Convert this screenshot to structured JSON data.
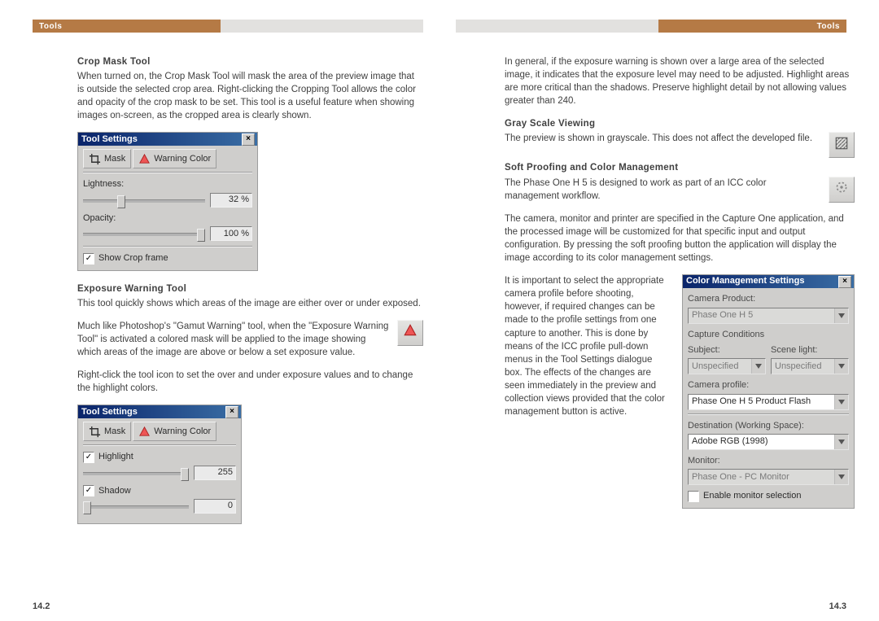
{
  "header": {
    "left": "Tools",
    "right": "Tools"
  },
  "footer": {
    "left": "14.2",
    "right": "14.3"
  },
  "left": {
    "h1": "Crop Mask Tool",
    "p1": "When turned on, the Crop Mask Tool will mask the area of the preview image that is outside the selected crop area. Right-clicking the Cropping Tool allows the color and opacity of the crop mask to be set. This tool is a useful feature when showing images on-screen, as the cropped area is clearly shown.",
    "dlg1": {
      "title": "Tool Settings",
      "btn_mask": "Mask",
      "btn_warn": "Warning Color",
      "lbl_lightness": "Lightness:",
      "val_lightness": "32 %",
      "lbl_opacity": "Opacity:",
      "val_opacity": "100 %",
      "chk_frame": "Show Crop frame"
    },
    "h2": "Exposure Warning Tool",
    "p2": "This tool quickly shows which areas of the image are either over or under exposed.",
    "p3": "Much like Photoshop's \"Gamut Warning\" tool, when the \"Exposure Warning Tool\" is activated a colored mask will be applied to the image showing which areas of the image are above or below a set exposure value.",
    "p4": "Right-click the tool icon to set the over and under exposure values and to change the highlight colors.",
    "dlg2": {
      "title": "Tool Settings",
      "btn_mask": "Mask",
      "btn_warn": "Warning Color",
      "chk_high": "Highlight",
      "val_high": "255",
      "chk_shadow": "Shadow",
      "val_shadow": "0"
    }
  },
  "right": {
    "p1": "In general, if the exposure warning is shown over a large area of the selected image, it indicates that the exposure level may need to be adjusted. Highlight areas are more critical than the shadows. Preserve highlight detail by not allowing values greater than 240.",
    "h1": "Gray Scale Viewing",
    "p2": "The preview is shown in grayscale. This does not affect the developed file.",
    "h2": "Soft Proofing and Color Management",
    "p3": "The Phase One H 5 is designed to work as part of an ICC color management workflow.",
    "p4": "The camera, monitor and printer are specified in the Capture One application, and the processed image will be customized for that specific input and output configuration. By pressing the soft proofing button the application will display the image according to its color management settings.",
    "p5": "It is important to select the appropriate camera profile before shooting, however, if required changes can be made to the profile settings from one capture to another. This is done by means of the ICC profile pull-down menus in the Tool Settings dialogue box. The effects of the changes are seen immediately in the preview and collection views provided that the color management button is active.",
    "cms": {
      "title": "Color Management Settings",
      "lbl_camprod": "Camera Product:",
      "val_camprod": "Phase One H 5",
      "lbl_capcond": "Capture Conditions",
      "lbl_subject": "Subject:",
      "val_subject": "Unspecified",
      "lbl_scene": "Scene light:",
      "val_scene": "Unspecified",
      "lbl_camprof": "Camera profile:",
      "val_camprof": "Phase One H 5  Product Flash",
      "lbl_dest": "Destination (Working Space):",
      "val_dest": "Adobe RGB (1998)",
      "lbl_monitor": "Monitor:",
      "val_monitor": "Phase One - PC Monitor",
      "chk_enable": "Enable monitor selection"
    }
  }
}
